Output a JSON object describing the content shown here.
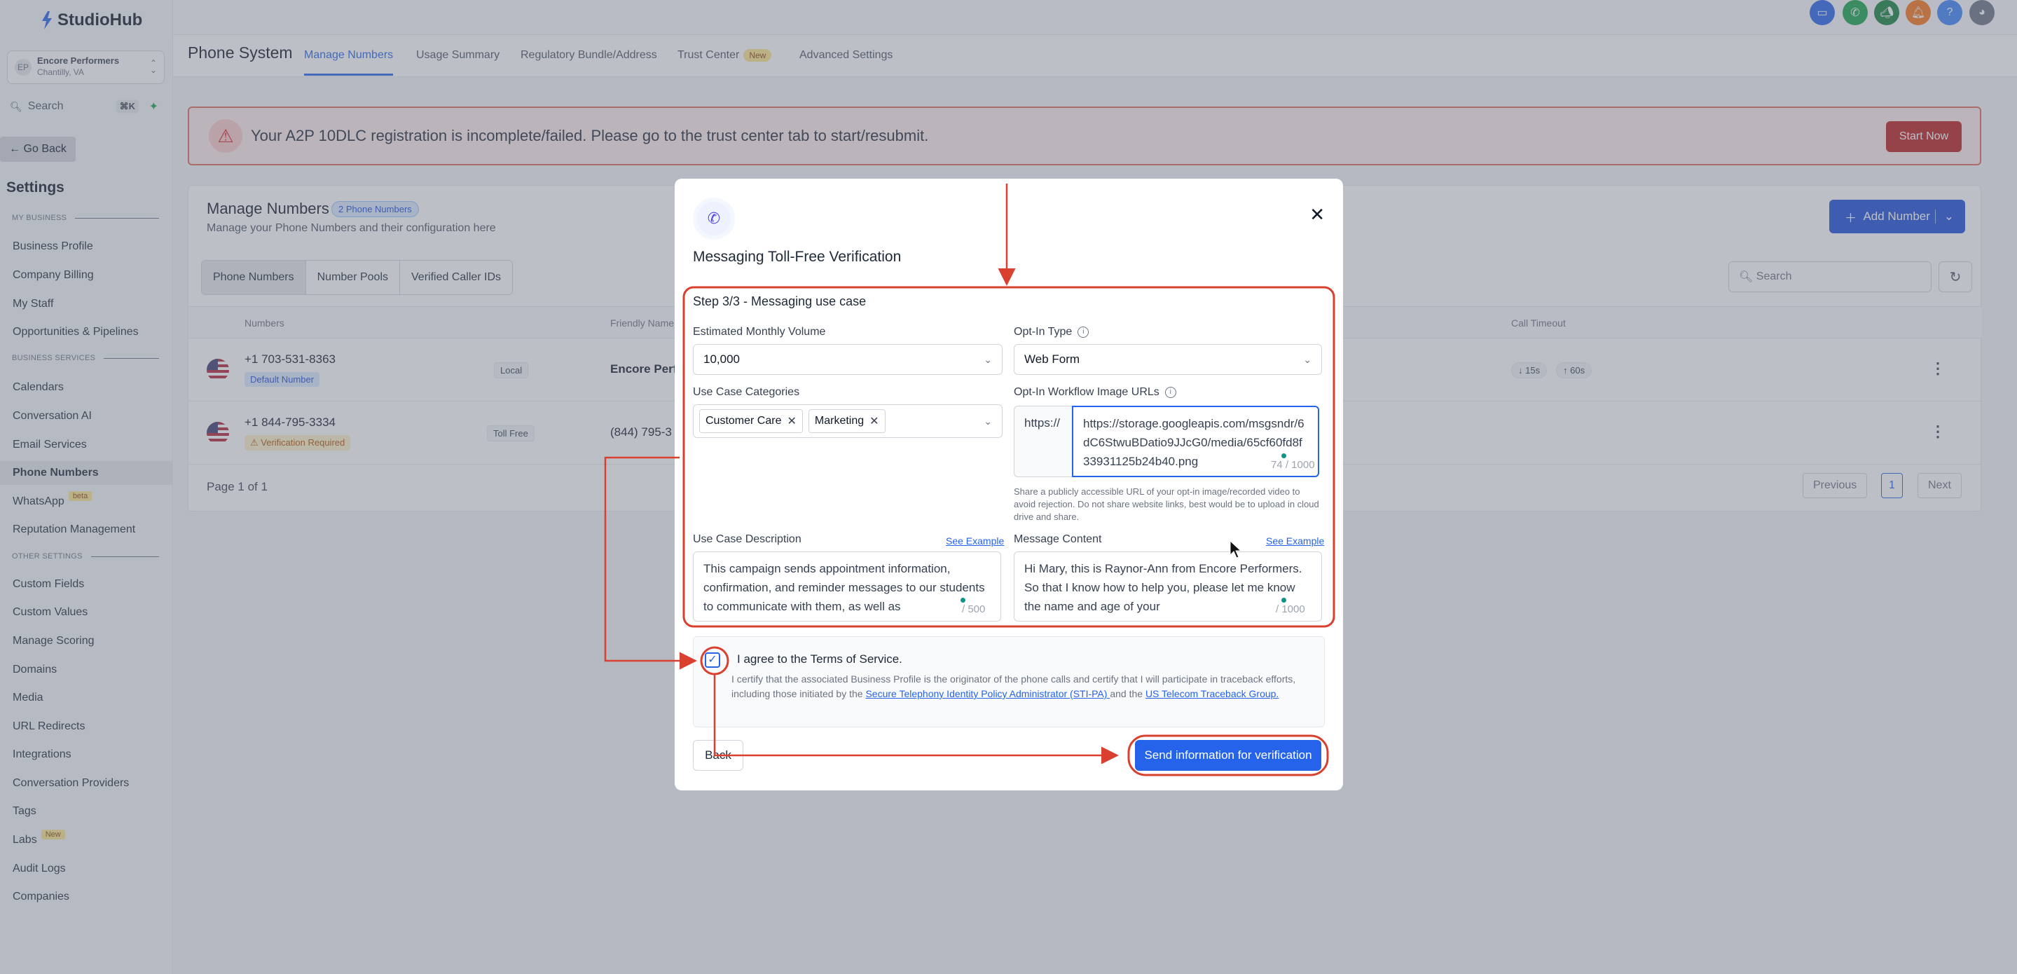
{
  "app": {
    "logo_text": "StudioHub"
  },
  "sidebar": {
    "account": {
      "avatar": "EP",
      "name": "Encore Performers",
      "location": "Chantilly, VA"
    },
    "search": {
      "label": "Search",
      "shortcut": "⌘K"
    },
    "go_back": "Go Back",
    "settings_title": "Settings",
    "sections": [
      "MY BUSINESS",
      "BUSINESS SERVICES",
      "OTHER SETTINGS"
    ],
    "items": [
      {
        "label": "Business Profile"
      },
      {
        "label": "Company Billing"
      },
      {
        "label": "My Staff"
      },
      {
        "label": "Opportunities & Pipelines"
      },
      {
        "label": "Calendars"
      },
      {
        "label": "Conversation AI"
      },
      {
        "label": "Email Services"
      },
      {
        "label": "Phone Numbers",
        "active": true
      },
      {
        "label": "WhatsApp",
        "badge": "beta"
      },
      {
        "label": "Reputation Management"
      },
      {
        "label": "Custom Fields"
      },
      {
        "label": "Custom Values"
      },
      {
        "label": "Manage Scoring"
      },
      {
        "label": "Domains"
      },
      {
        "label": "Media"
      },
      {
        "label": "URL Redirects"
      },
      {
        "label": "Integrations"
      },
      {
        "label": "Conversation Providers"
      },
      {
        "label": "Tags"
      },
      {
        "label": "Labs",
        "badge": "New"
      },
      {
        "label": "Audit Logs"
      },
      {
        "label": "Companies"
      }
    ]
  },
  "header": {
    "title": "Phone System",
    "tabs": [
      {
        "label": "Manage Numbers",
        "active": true
      },
      {
        "label": "Usage Summary"
      },
      {
        "label": "Regulatory Bundle/Address"
      },
      {
        "label": "Trust Center",
        "badge": "New"
      },
      {
        "label": "Advanced Settings"
      }
    ],
    "top_icons": [
      {
        "name": "chat-icon",
        "color": "#2563eb"
      },
      {
        "name": "phone-icon",
        "color": "#16a34a"
      },
      {
        "name": "megaphone-icon",
        "color": "#15803d"
      },
      {
        "name": "bell-icon",
        "color": "#f97316"
      },
      {
        "name": "help-icon",
        "color": "#3b82f6"
      }
    ]
  },
  "banner": {
    "message": "Your A2P 10DLC registration is incomplete/failed. Please go to the trust center tab to start/resubmit.",
    "button": "Start Now"
  },
  "manage": {
    "title": "Manage Numbers",
    "count_badge": "2 Phone Numbers",
    "subtitle": "Manage your Phone Numbers and their configuration here",
    "add_button": "Add Number",
    "segments": [
      "Phone Numbers",
      "Number Pools",
      "Verified Caller IDs"
    ],
    "search_placeholder": "Search",
    "columns": {
      "numbers": "Numbers",
      "friendly": "Friendly Name",
      "timeout": "Call Timeout"
    },
    "rows": [
      {
        "number": "+1 703-531-8363",
        "tag": "Default Number",
        "type": "Local",
        "friendly": "Encore Perfo",
        "timeout_in": "15s",
        "timeout_out": "60s"
      },
      {
        "number": "+1 844-795-3334",
        "tag": "Verification Required",
        "type": "Toll Free",
        "friendly": "(844) 795-3"
      }
    ],
    "pagination": {
      "label": "Page 1 of 1",
      "prev": "Previous",
      "page": "1",
      "next": "Next"
    }
  },
  "modal": {
    "title": "Messaging Toll-Free Verification",
    "step": "Step 3/3 - Messaging use case",
    "volume": {
      "label": "Estimated Monthly Volume",
      "value": "10,000"
    },
    "optin_type": {
      "label": "Opt-In Type",
      "value": "Web Form"
    },
    "categories": {
      "label": "Use Case Categories",
      "chips": [
        "Customer Care",
        "Marketing"
      ]
    },
    "optin_urls": {
      "label": "Opt-In Workflow Image URLs",
      "prefix": "https://",
      "value": "https://storage.googleapis.com/msgsndr/6dC6StwuBDatio9JJcG0/media/65cf60fd8f33931125b24b40.png",
      "counter": "74 / 1000",
      "hint": "Share a publicly accessible URL of your opt-in image/recorded video to avoid rejection. Do not share website links, best would be to upload in cloud drive and share."
    },
    "description": {
      "label": "Use Case Description",
      "see_example": "See Example",
      "value": "This campaign sends appointment information, confirmation, and reminder messages to our students to communicate with them, as well as",
      "counter": "/ 500"
    },
    "message": {
      "label": "Message Content",
      "see_example": "See Example",
      "value": "Hi Mary, this is Raynor-Ann from Encore Performers. So that I know how to help you, please let me know the name and age of your",
      "counter": "/ 1000"
    },
    "tos": {
      "label": "I agree to the Terms of Service.",
      "text_1": "I certify that the associated Business Profile is the originator of the phone calls and certify that I will participate in traceback efforts, including those initiated by the ",
      "link_1": "Secure Telephony Identity Policy Administrator (STI-PA) ",
      "text_2": "and the ",
      "link_2": "US Telecom Traceback Group."
    },
    "back": "Back",
    "submit": "Send information for verification"
  },
  "colors": {
    "accent": "#2563eb",
    "annotation": "#d9402f",
    "danger": "#b91c1c"
  }
}
